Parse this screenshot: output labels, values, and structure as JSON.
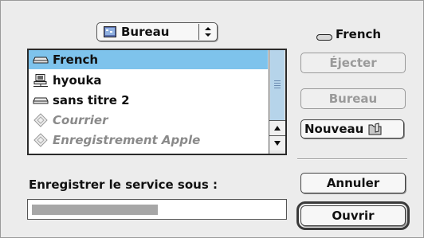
{
  "popup": {
    "label": "Bureau",
    "icon": "desktop-icon"
  },
  "current_volume": {
    "label": "French",
    "icon": "disk-icon"
  },
  "list": {
    "items": [
      {
        "label": "French",
        "icon": "disk-icon",
        "selected": true,
        "disabled": false
      },
      {
        "label": "hyouka",
        "icon": "network-icon",
        "selected": false,
        "disabled": false
      },
      {
        "label": "sans titre 2",
        "icon": "disk-icon",
        "selected": false,
        "disabled": false
      },
      {
        "label": "Courrier",
        "icon": "app-alias-icon",
        "selected": false,
        "disabled": true
      },
      {
        "label": "Enregistrement Apple",
        "icon": "app-alias-icon",
        "selected": false,
        "disabled": true
      }
    ]
  },
  "buttons": {
    "eject": "Éjecter",
    "desktop": "Bureau",
    "new": "Nouveau",
    "cancel": "Annuler",
    "open": "Ouvrir"
  },
  "save_label": "Enregistrer le service sous :",
  "colors": {
    "selection": "#7ec3ec",
    "thumb": "#b6d4ea"
  }
}
